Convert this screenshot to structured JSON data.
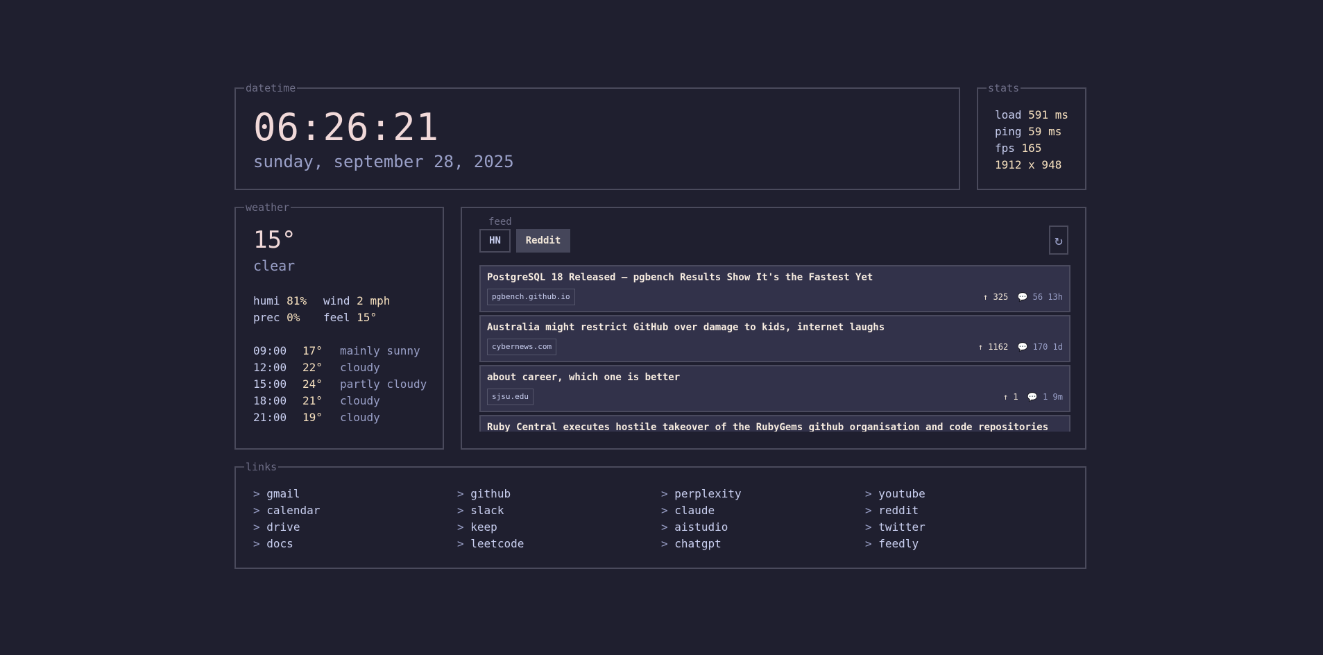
{
  "datetime": {
    "legend": "datetime",
    "time": "06:26:21",
    "date": "sunday, september 28, 2025"
  },
  "stats": {
    "legend": "stats",
    "load_key": "load",
    "load_val": "591 ms",
    "ping_key": "ping",
    "ping_val": "59 ms",
    "fps_key": "fps",
    "fps_val": "165",
    "resolution": "1912 x 948"
  },
  "weather": {
    "legend": "weather",
    "temp": "15°",
    "condition": "clear",
    "humi_key": "humi",
    "humi_val": "81%",
    "wind_key": "wind",
    "wind_val": "2 mph",
    "prec_key": "prec",
    "prec_val": "0%",
    "feel_key": "feel",
    "feel_val": "15°",
    "forecast": [
      {
        "time": "09:00",
        "temp": "17°",
        "cond": "mainly sunny"
      },
      {
        "time": "12:00",
        "temp": "22°",
        "cond": "cloudy"
      },
      {
        "time": "15:00",
        "temp": "24°",
        "cond": "partly cloudy"
      },
      {
        "time": "18:00",
        "temp": "21°",
        "cond": "cloudy"
      },
      {
        "time": "21:00",
        "temp": "19°",
        "cond": "cloudy"
      }
    ]
  },
  "feed": {
    "label": "feed",
    "tabs": [
      {
        "label": "HN",
        "active": false
      },
      {
        "label": "Reddit",
        "active": true
      }
    ],
    "refresh_icon": "refresh-icon",
    "items": [
      {
        "title": "PostgreSQL 18 Released — pgbench Results Show It's the Fastest Yet",
        "domain": "pgbench.github.io",
        "score": "325",
        "comments": "56",
        "age": "13h"
      },
      {
        "title": "Australia might restrict GitHub over damage to kids, internet laughs",
        "domain": "cybernews.com",
        "score": "1162",
        "comments": "170",
        "age": "1d"
      },
      {
        "title": "about career, which one is better",
        "domain": "sjsu.edu",
        "score": "1",
        "comments": "1",
        "age": "9m"
      },
      {
        "title": "Ruby Central executes hostile takeover of the RubyGems github organisation and code repositories",
        "domain": "",
        "score": "",
        "comments": "",
        "age": ""
      }
    ]
  },
  "links": {
    "legend": "links",
    "prefix": ">",
    "columns": [
      [
        "gmail",
        "calendar",
        "drive",
        "docs"
      ],
      [
        "github",
        "slack",
        "keep",
        "leetcode"
      ],
      [
        "perplexity",
        "claude",
        "aistudio",
        "chatgpt"
      ],
      [
        "youtube",
        "reddit",
        "twitter",
        "feedly"
      ]
    ]
  },
  "colors": {
    "background": "#1f1f2f",
    "border": "#4a4a5c",
    "accent_text": "#f7e1bf",
    "muted": "#9aa0c8"
  }
}
